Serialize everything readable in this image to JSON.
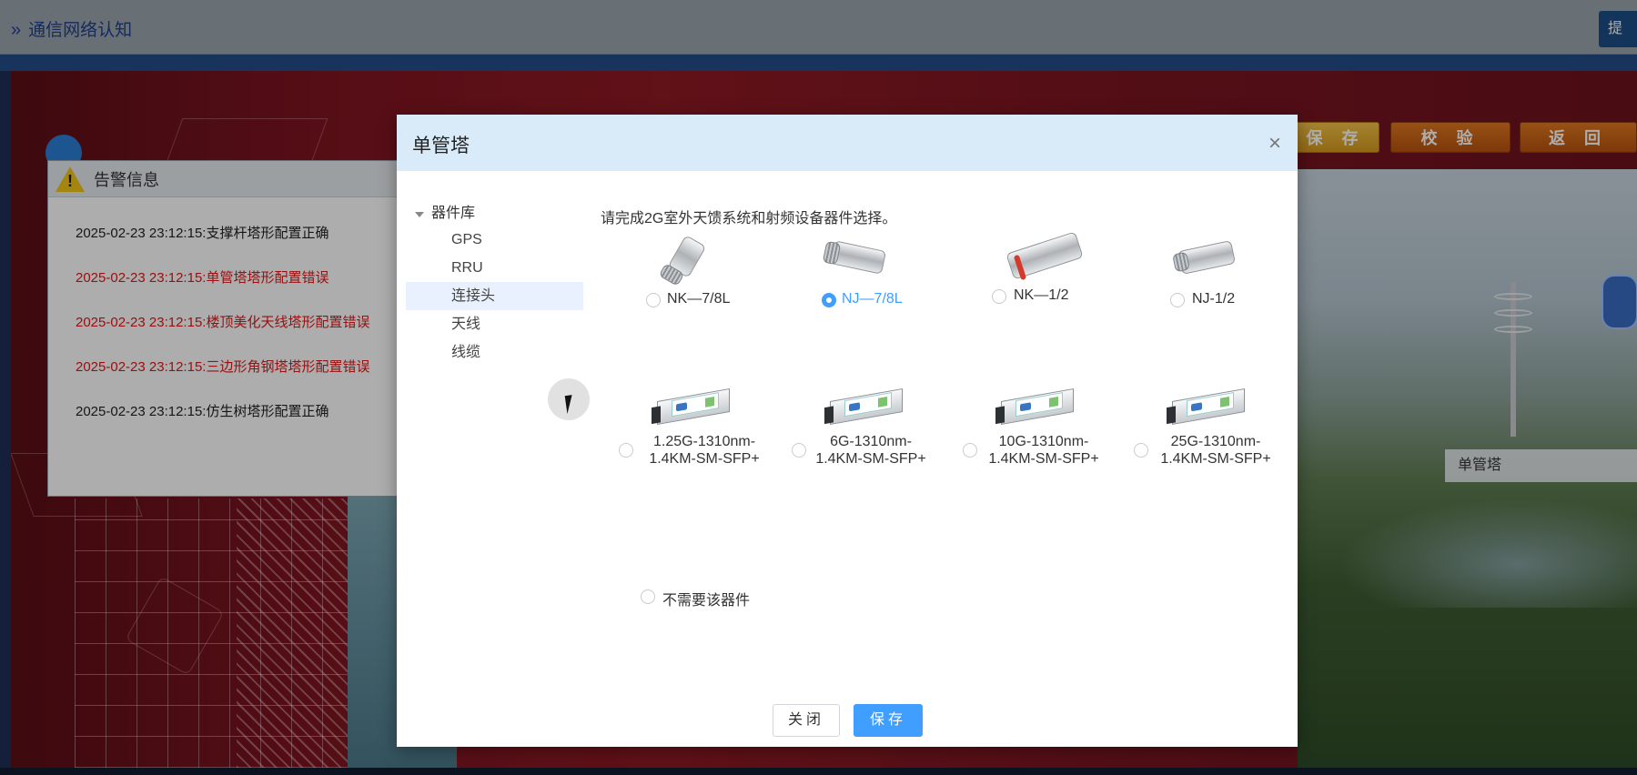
{
  "header": {
    "breadcrumb": "通信网络认知",
    "chevron": "»",
    "submit_label": "提"
  },
  "actions": {
    "save_label": "保 存",
    "check_label": "校 验",
    "back_label": "返 回"
  },
  "scene": {
    "tower_label": "单管塔"
  },
  "alarm": {
    "title": "告警信息",
    "messages": [
      {
        "text": "2025-02-23 23:12:15:支撑杆塔形配置正确",
        "status": "ok"
      },
      {
        "text": "2025-02-23 23:12:15:单管塔塔形配置错误",
        "status": "error"
      },
      {
        "text": "2025-02-23 23:12:15:楼顶美化天线塔形配置错误",
        "status": "error"
      },
      {
        "text": "2025-02-23 23:12:15:三边形角钢塔塔形配置错误",
        "status": "error"
      },
      {
        "text": "2025-02-23 23:12:15:仿生树塔形配置正确",
        "status": "ok"
      }
    ]
  },
  "modal": {
    "title": "单管塔",
    "close_icon": "×",
    "instruction": "请完成2G室外天馈系统和射频设备器件选择。",
    "tree": {
      "root": "器件库",
      "items": [
        "GPS",
        "RRU",
        "连接头",
        "天线",
        "线缆"
      ],
      "selected": "连接头"
    },
    "options_row1": [
      {
        "label": "NK—7/8L",
        "checked": false
      },
      {
        "label": "NJ—7/8L",
        "checked": true
      },
      {
        "label": "NK—1/2",
        "checked": false
      },
      {
        "label": "NJ-1/2",
        "checked": false
      }
    ],
    "options_row2": [
      {
        "label": "1.25G-1310nm-1.4KM-SM-SFP+",
        "checked": false
      },
      {
        "label": "6G-1310nm-1.4KM-SM-SFP+",
        "checked": false
      },
      {
        "label": "10G-1310nm-1.4KM-SM-SFP+",
        "checked": false
      },
      {
        "label": "25G-1310nm-1.4KM-SM-SFP+",
        "checked": false
      }
    ],
    "none_option": {
      "label": "不需要该器件",
      "checked": false
    },
    "footer": {
      "close_label": "关闭",
      "save_label": "保存"
    }
  },
  "colors": {
    "accent": "#409eff",
    "error_text": "#e01818",
    "modal_header": "#d9ebf8",
    "scene_red": "#8f1a24"
  }
}
